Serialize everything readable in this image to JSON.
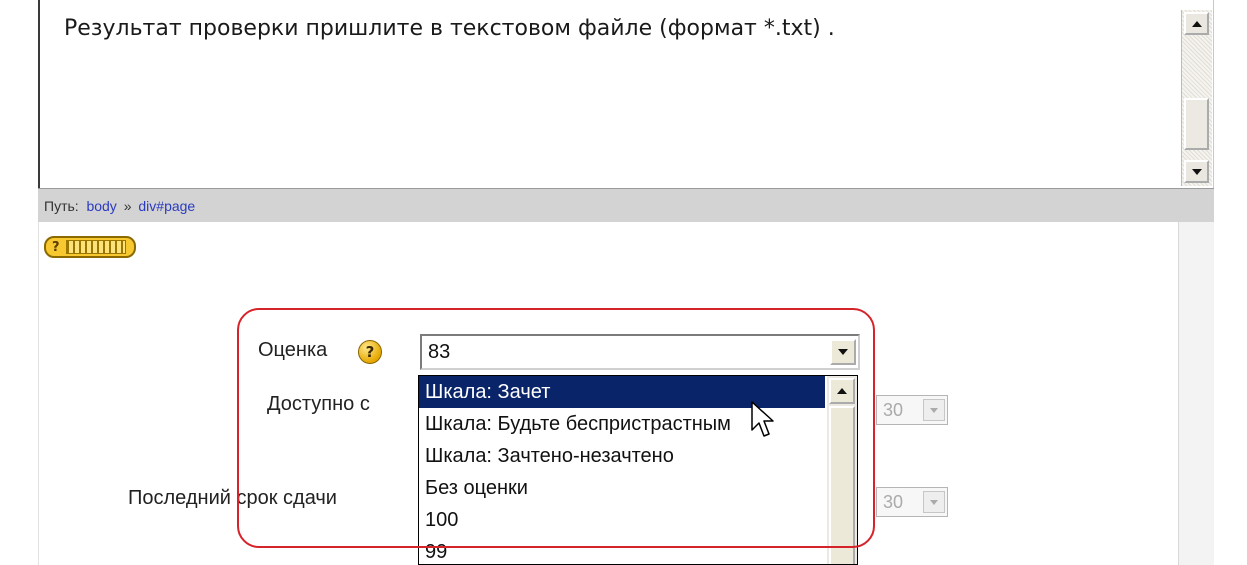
{
  "editor": {
    "text": "Результат проверки пришлите в текстовом файле (формат *.txt) ."
  },
  "pathbar": {
    "label": "Путь:",
    "crumbs": [
      "body",
      "div#page"
    ],
    "separator": "»"
  },
  "form": {
    "grade_label": "Оценка",
    "grade_help_icon": "question-icon",
    "grade_value": "83",
    "available_label": "Доступно с",
    "due_label": "Последний срок сдачи",
    "minute_value_1": "30",
    "minute_value_2": "30",
    "dropdown_options": [
      "Шкала: Зачет",
      "Шкала: Будьте беспристрастным",
      "Шкала: Зачтено-незачтено",
      "Без оценки",
      "100",
      "99"
    ]
  },
  "colors": {
    "selection": "#0a246a",
    "highlight_outline": "#d6232a",
    "link": "#2b3bbf"
  }
}
